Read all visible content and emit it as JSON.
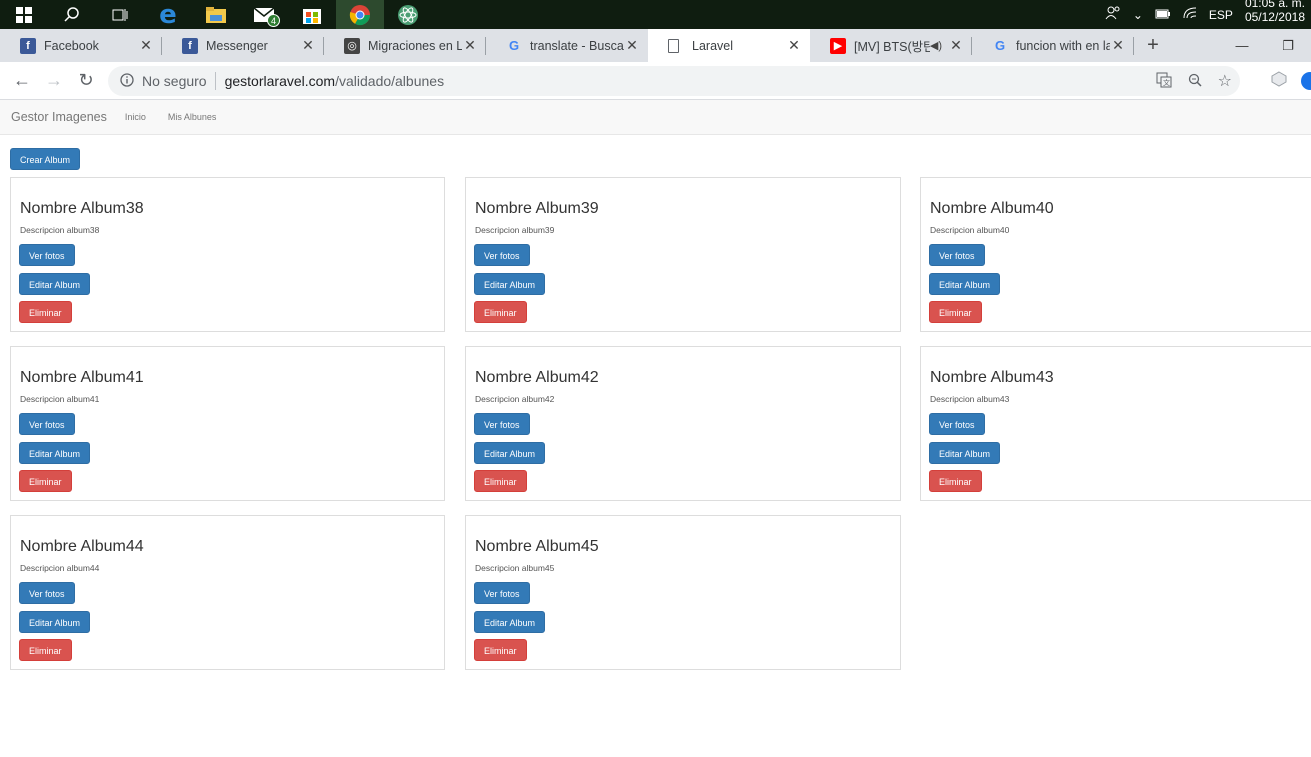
{
  "taskbar": {
    "badge_count": "4",
    "language": "ESP",
    "clock_time": "01:05 a. m.",
    "clock_date": "05/12/2018",
    "icons": [
      "windows-icon",
      "search-icon",
      "task-view-icon",
      "edge-icon",
      "file-explorer-icon",
      "mail-icon",
      "store-icon",
      "chrome-icon",
      "atom-icon"
    ]
  },
  "browser": {
    "tabs": [
      {
        "title": "Facebook",
        "favicon": "facebook-icon",
        "color": "#3b5998",
        "glyph": "f"
      },
      {
        "title": "Messenger",
        "favicon": "facebook-icon",
        "color": "#3b5998",
        "glyph": "f"
      },
      {
        "title": "Migraciones en La",
        "favicon": "laravel-doc-icon",
        "color": "#444444",
        "glyph": "◎"
      },
      {
        "title": "translate - Buscar c",
        "favicon": "google-icon",
        "color": "#ffffff",
        "glyph": "G"
      },
      {
        "title": "Laravel",
        "favicon": "page-icon",
        "color": "#ffffff",
        "glyph": ""
      },
      {
        "title": "[MV] BTS(방탄",
        "favicon": "youtube-icon",
        "color": "#ff0000",
        "glyph": "▶"
      },
      {
        "title": "funcion with en lar",
        "favicon": "google-icon",
        "color": "#ffffff",
        "glyph": "G"
      }
    ],
    "active_tab": 4,
    "security_text": "No seguro",
    "url_host": "gestorlaravel.com",
    "url_path": "/validado/albunes"
  },
  "navbar": {
    "brand": "Gestor Imagenes",
    "links": [
      "Inicio",
      "Mis Albunes"
    ]
  },
  "create_label": "Crear Album",
  "albums": [
    {
      "name": "Nombre Album38",
      "description": "Descripcion album38"
    },
    {
      "name": "Nombre Album39",
      "description": "Descripcion album39"
    },
    {
      "name": "Nombre Album40",
      "description": "Descripcion album40"
    },
    {
      "name": "Nombre Album41",
      "description": "Descripcion album41"
    },
    {
      "name": "Nombre Album42",
      "description": "Descripcion album42"
    },
    {
      "name": "Nombre Album43",
      "description": "Descripcion album43"
    },
    {
      "name": "Nombre Album44",
      "description": "Descripcion album44"
    },
    {
      "name": "Nombre Album45",
      "description": "Descripcion album45"
    }
  ],
  "album_actions": {
    "view": "Ver fotos",
    "edit": "Editar Album",
    "delete": "Eliminar"
  },
  "colors": {
    "primary": "#337ab7",
    "danger": "#d9534f",
    "taskbar": "#0f1d10"
  }
}
